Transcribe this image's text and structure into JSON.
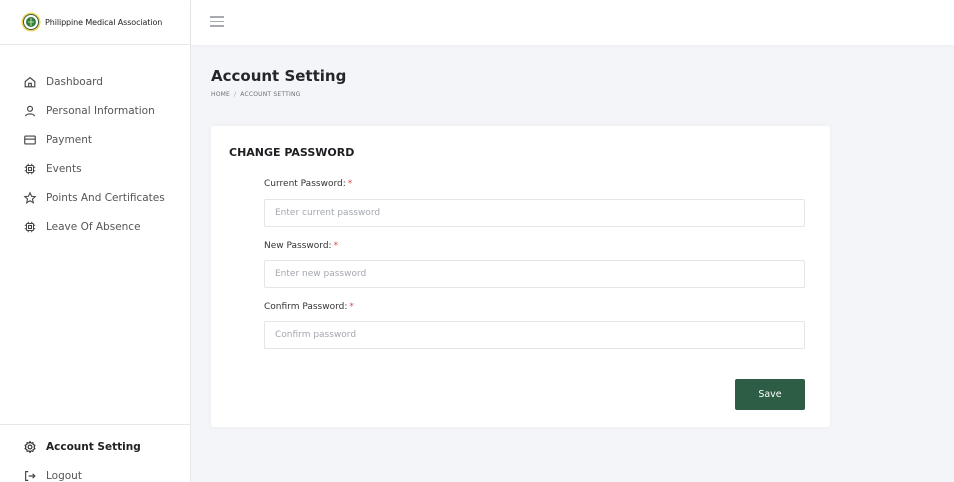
{
  "brand": {
    "name": "Philippine Medical Association",
    "accent": "#2e5d45"
  },
  "sidebar": {
    "items": [
      {
        "label": "Dashboard",
        "icon": "home-icon"
      },
      {
        "label": "Personal Information",
        "icon": "user-icon"
      },
      {
        "label": "Payment",
        "icon": "card-icon"
      },
      {
        "label": "Events",
        "icon": "chip-icon"
      },
      {
        "label": "Points And Certificates",
        "icon": "star-icon"
      },
      {
        "label": "Leave Of Absence",
        "icon": "chip-icon"
      }
    ],
    "bottom": [
      {
        "label": "Account Setting",
        "icon": "gear-icon",
        "active": true
      },
      {
        "label": "Logout",
        "icon": "logout-icon"
      }
    ]
  },
  "header": {
    "menu_icon": "hamburger-icon"
  },
  "main": {
    "title": "Account Setting",
    "breadcrumb": {
      "home": "HOME",
      "separator": "/",
      "current": "ACCOUNT SETTING"
    },
    "card": {
      "title": "CHANGE PASSWORD",
      "fields": [
        {
          "label": "Current Password:",
          "required": "*",
          "placeholder": "Enter current password",
          "value": ""
        },
        {
          "label": "New Password:",
          "required": "*",
          "placeholder": "Enter new password",
          "value": ""
        },
        {
          "label": "Confirm Password:",
          "required": "*",
          "placeholder": "Confirm password",
          "value": ""
        }
      ],
      "save_label": "Save"
    }
  }
}
